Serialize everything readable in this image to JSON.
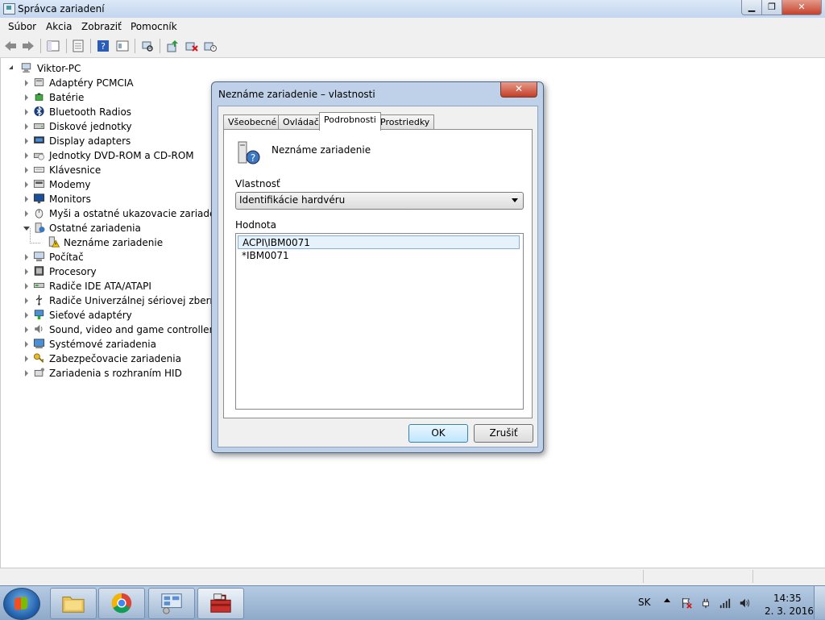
{
  "window": {
    "title": "Správca zariadení"
  },
  "menu": [
    "Súbor",
    "Akcia",
    "Zobraziť",
    "Pomocník"
  ],
  "tree": {
    "root": "Viktor-PC",
    "items": [
      {
        "label": "Adaptéry PCMCIA",
        "icon": "pcmcia-icon"
      },
      {
        "label": "Batérie",
        "icon": "battery-icon"
      },
      {
        "label": "Bluetooth Radios",
        "icon": "bluetooth-icon"
      },
      {
        "label": "Diskové jednotky",
        "icon": "disk-drive-icon"
      },
      {
        "label": "Display adapters",
        "icon": "display-adapter-icon"
      },
      {
        "label": "Jednotky DVD-ROM a CD-ROM",
        "icon": "dvd-drive-icon"
      },
      {
        "label": "Klávesnice",
        "icon": "keyboard-icon"
      },
      {
        "label": "Modemy",
        "icon": "modem-icon"
      },
      {
        "label": "Monitors",
        "icon": "monitor-icon"
      },
      {
        "label": "Myši a ostatné ukazovacie zariadenia",
        "icon": "mouse-icon"
      },
      {
        "label": "Ostatné zariadenia",
        "icon": "other-devices-icon",
        "expanded": true
      },
      {
        "label": "Neznáme zariadenie",
        "icon": "warning-device-icon",
        "child": true
      },
      {
        "label": "Počítač",
        "icon": "computer-icon"
      },
      {
        "label": "Procesory",
        "icon": "processor-icon"
      },
      {
        "label": "Radiče IDE ATA/ATAPI",
        "icon": "ide-controller-icon"
      },
      {
        "label": "Radiče Univerzálnej sériovej zbernice",
        "icon": "usb-icon"
      },
      {
        "label": "Sieťové adaptéry",
        "icon": "network-adapter-icon"
      },
      {
        "label": "Sound, video and game controllers",
        "icon": "sound-icon"
      },
      {
        "label": "Systémové zariadenia",
        "icon": "system-device-icon"
      },
      {
        "label": "Zabezpečovacie zariadenia",
        "icon": "security-key-icon"
      },
      {
        "label": "Zariadenia s rozhraním HID",
        "icon": "hid-icon"
      }
    ]
  },
  "dialog": {
    "title": "Neznáme zariadenie – vlastnosti",
    "tabs": [
      "Všeobecné",
      "Ovládač",
      "Podrobnosti",
      "Prostriedky"
    ],
    "active_tab": "Podrobnosti",
    "device_name": "Neznáme zariadenie",
    "property_label": "Vlastnosť",
    "property_value": "Identifikácie hardvéru",
    "value_label": "Hodnota",
    "values": [
      "ACPI\\IBM0071",
      "*IBM0071"
    ],
    "ok": "OK",
    "cancel": "Zrušiť"
  },
  "taskbar": {
    "language": "SK",
    "time": "14:35",
    "date": "2. 3. 2016"
  },
  "colors": {
    "accent": "#3c7fb1",
    "selection": "#e5f1fb",
    "taskbar": "#8ea9c9"
  }
}
